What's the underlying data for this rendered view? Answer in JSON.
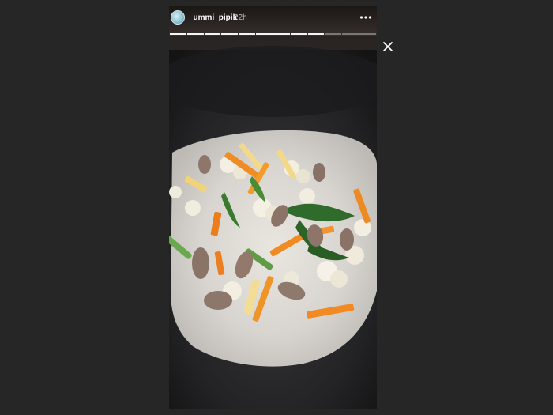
{
  "story": {
    "username": "_ummi_pipik_",
    "timestamp": "22h",
    "progress": {
      "total_segments": 12,
      "completed_segments": 9
    }
  },
  "icons": {
    "more": "more-horizontal-icon",
    "close": "close-icon"
  },
  "colors": {
    "backdrop": "#262626",
    "text": "#ffffff"
  }
}
